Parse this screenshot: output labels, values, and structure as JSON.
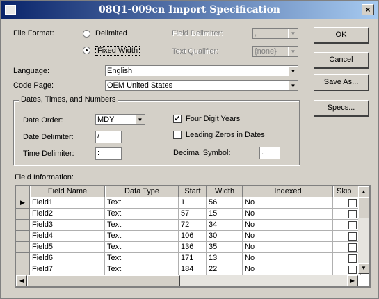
{
  "title": "08Q1-009cn Import Specification",
  "close_glyph": "×",
  "file_format": {
    "label": "File Format:",
    "delimited": "Delimited",
    "fixed_width": "Fixed Width",
    "selected": "Fixed Width",
    "field_delimiter_label": "Field Delimiter:",
    "field_delimiter_value": ",",
    "text_qualifier_label": "Text Qualifier:",
    "text_qualifier_value": "{none}"
  },
  "language": {
    "label": "Language:",
    "value": "English"
  },
  "code_page": {
    "label": "Code Page:",
    "value": "OEM United States"
  },
  "dates": {
    "group_label": "Dates, Times, and Numbers",
    "date_order_label": "Date Order:",
    "date_order_value": "MDY",
    "date_delimiter_label": "Date Delimiter:",
    "date_delimiter_value": "/",
    "time_delimiter_label": "Time Delimiter:",
    "time_delimiter_value": ":",
    "four_digit_years_label": "Four Digit Years",
    "four_digit_years_checked": true,
    "leading_zeros_label": "Leading Zeros in Dates",
    "leading_zeros_checked": false,
    "decimal_symbol_label": "Decimal Symbol:",
    "decimal_symbol_value": "."
  },
  "buttons": {
    "ok": "OK",
    "cancel": "Cancel",
    "save_as": "Save As...",
    "specs": "Specs..."
  },
  "field_info": {
    "label": "Field Information:",
    "columns": [
      "Field Name",
      "Data Type",
      "Start",
      "Width",
      "Indexed",
      "Skip"
    ],
    "rows": [
      {
        "name": "Field1",
        "type": "Text",
        "start": "1",
        "width": "56",
        "indexed": "No"
      },
      {
        "name": "Field2",
        "type": "Text",
        "start": "57",
        "width": "15",
        "indexed": "No"
      },
      {
        "name": "Field3",
        "type": "Text",
        "start": "72",
        "width": "34",
        "indexed": "No"
      },
      {
        "name": "Field4",
        "type": "Text",
        "start": "106",
        "width": "30",
        "indexed": "No"
      },
      {
        "name": "Field5",
        "type": "Text",
        "start": "136",
        "width": "35",
        "indexed": "No"
      },
      {
        "name": "Field6",
        "type": "Text",
        "start": "171",
        "width": "13",
        "indexed": "No"
      },
      {
        "name": "Field7",
        "type": "Text",
        "start": "184",
        "width": "22",
        "indexed": "No"
      }
    ]
  },
  "icons": {
    "current_row": "row-pointer-icon",
    "dropdown": "chevron-down-icon"
  }
}
